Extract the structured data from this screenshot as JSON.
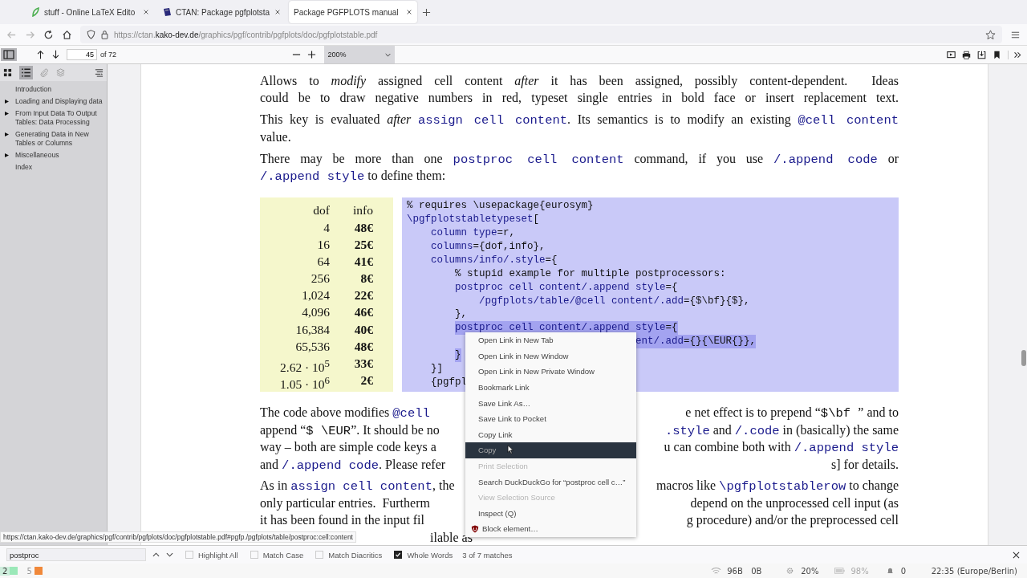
{
  "tabs": [
    {
      "label": "stuff - Online LaTeX Edito",
      "selected": false
    },
    {
      "label": "CTAN: Package pgfplotsta",
      "selected": false
    },
    {
      "label": "Package PGFPLOTS manual",
      "selected": true
    }
  ],
  "address": {
    "scheme": "https://ctan.",
    "domain": "kako-dev.de",
    "path": "/graphics/pgf/contrib/pgfplots/doc/pgfplotstable.pdf"
  },
  "pdf_toolbar": {
    "page": "45",
    "page_count": "of 72",
    "zoom": "200%"
  },
  "sidebar": {
    "items": [
      {
        "label": "Introduction",
        "kind": "leaf"
      },
      {
        "label": "Loading and Displaying data",
        "kind": "branch"
      },
      {
        "label": "From Input Data To Output Tables: Data Processing",
        "kind": "branch"
      },
      {
        "label": "Generating Data in New Tables or Columns",
        "kind": "branch"
      },
      {
        "label": "Miscellaneous",
        "kind": "branch"
      },
      {
        "label": "Index",
        "kind": "leaf"
      }
    ]
  },
  "document": {
    "top_paragraphs": [
      {
        "lines": [
          {
            "kind": "full",
            "left": [
              {
                "kind": "text",
                "t": "Allows to "
              },
              {
                "kind": "em",
                "t": "modify"
              },
              {
                "kind": "text",
                "t": " assigned cell content "
              },
              {
                "kind": "em",
                "t": "after"
              },
              {
                "kind": "text",
                "t": " it has been assigned, possibly content-dependent.  Ideas"
              }
            ]
          },
          {
            "kind": "full",
            "left": [
              {
                "kind": "text",
                "t": "could be to draw negative numbers in red, typeset single entries in bold face or insert replacement text."
              }
            ]
          }
        ]
      },
      {
        "lines": [
          {
            "kind": "full",
            "left": [
              {
                "kind": "text",
                "t": "This key is evaluated "
              },
              {
                "kind": "em",
                "t": "after "
              },
              {
                "kind": "code",
                "t": "assign cell content"
              },
              {
                "kind": "text",
                "t": ". Its semantics is to modify an existing "
              },
              {
                "kind": "code",
                "t": "@cell content"
              }
            ]
          },
          {
            "kind": "last",
            "left": [
              {
                "kind": "text",
                "t": "value."
              }
            ]
          }
        ]
      },
      {
        "lines": [
          {
            "kind": "full",
            "left": [
              {
                "kind": "text",
                "t": "There may be more than one "
              },
              {
                "kind": "code",
                "t": "postproc cell content"
              },
              {
                "kind": "text",
                "t": " command, if you use "
              },
              {
                "kind": "code",
                "t": "/.append code"
              },
              {
                "kind": "text",
                "t": " or"
              }
            ]
          },
          {
            "kind": "last",
            "left": [
              {
                "kind": "code",
                "t": "/.append style"
              },
              {
                "kind": "text",
                "t": " to define them:"
              }
            ]
          }
        ]
      }
    ],
    "example_table": {
      "columns": [
        "dof",
        "info"
      ],
      "rows": [
        [
          "4",
          "48€"
        ],
        [
          "16",
          "25€"
        ],
        [
          "64",
          "41€"
        ],
        [
          "256",
          "8€"
        ],
        [
          "1,024",
          "22€"
        ],
        [
          "4,096",
          "46€"
        ],
        [
          "16,384",
          "40€"
        ],
        [
          "65,536",
          "48€"
        ],
        [
          "2.62 · 10$^{5}$",
          "33€"
        ],
        [
          "1.05 · 10$^{6}$",
          "2€"
        ]
      ]
    },
    "code": [
      {
        "covered": false,
        "selected": false,
        "segs": [
          {
            "kind": "plain",
            "t": "% requires \\usepackage{eurosym}"
          }
        ]
      },
      {
        "covered": false,
        "selected": false,
        "segs": [
          {
            "kind": "kw",
            "t": "\\pgfplotstabletypeset"
          },
          {
            "kind": "plain",
            "t": "["
          }
        ],
        "children": [
          {
            "covered": false,
            "selected": false,
            "segs": [
              {
                "kind": "kw",
                "t": "column type"
              },
              {
                "kind": "plain",
                "t": "=r,"
              }
            ]
          },
          {
            "covered": false,
            "selected": false,
            "segs": [
              {
                "kind": "kw",
                "t": "columns"
              },
              {
                "kind": "plain",
                "t": "={dof,info},"
              }
            ]
          },
          {
            "covered": false,
            "selected": false,
            "segs": [
              {
                "kind": "kw",
                "t": "columns/info/.style"
              },
              {
                "kind": "plain",
                "t": "={"
              }
            ],
            "children": [
              {
                "covered": false,
                "selected": false,
                "segs": [
                  {
                    "kind": "plain",
                    "t": "% stupid example for multiple postprocessors:"
                  }
                ]
              },
              {
                "covered": false,
                "selected": false,
                "segs": [
                  {
                    "kind": "kw",
                    "t": "postproc cell content/.append style"
                  },
                  {
                    "kind": "plain",
                    "t": "={"
                  }
                ],
                "children": [
                  {
                    "covered": false,
                    "selected": false,
                    "segs": [
                      {
                        "kind": "kw",
                        "t": "/pgfplots/table/@cell content/.add"
                      },
                      {
                        "kind": "plain",
                        "t": "={$\\bf}{$},"
                      }
                    ]
                  }
                ]
              },
              {
                "covered": false,
                "selected": false,
                "segs": [
                  {
                    "kind": "plain",
                    "t": "},"
                  }
                ]
              },
              {
                "covered": false,
                "selected": true,
                "segs": [
                  {
                    "kind": "kw",
                    "t": "postproc cell content/.append style"
                  },
                  {
                    "kind": "plain",
                    "t": "={"
                  }
                ],
                "children": [
                  {
                    "covered": true,
                    "selected": true,
                    "segs": [
                      {
                        "kind": "kw",
                        "t": "ent/.add"
                      },
                      {
                        "kind": "plain",
                        "t": "={}{\\EUR{}},"
                      }
                    ]
                  }
                ]
              },
              {
                "covered": false,
                "selected": true,
                "segs": [
                  {
                    "kind": "plain",
                    "t": "}"
                  }
                ]
              }
            ]
          },
          {
            "covered": false,
            "selected": false,
            "segs": [
              {
                "kind": "plain",
                "t": "}]"
              }
            ]
          },
          {
            "covered": false,
            "selected": false,
            "segs": [
              {
                "kind": "plain",
                "t": "{pgfpl"
              }
            ]
          }
        ]
      }
    ],
    "bottom_paragraphs": [
      {
        "lines": [
          {
            "kind": "split",
            "left": [
              {
                "kind": "text",
                "t": "The code above modifies "
              },
              {
                "kind": "code",
                "t": "@cell"
              }
            ],
            "right": [
              {
                "kind": "text",
                "t": "e net effect is to prepend “"
              },
              {
                "kind": "mono",
                "t": "$\\bf "
              },
              {
                "kind": "text",
                "t": "” and to"
              }
            ]
          },
          {
            "kind": "split",
            "left": [
              {
                "kind": "text",
                "t": "append “"
              },
              {
                "kind": "mono",
                "t": "$ \\EUR"
              },
              {
                "kind": "text",
                "t": "”. It should be no"
              }
            ],
            "right": [
              {
                "kind": "code",
                "t": ".style"
              },
              {
                "kind": "text",
                "t": " and "
              },
              {
                "kind": "code",
                "t": "/.code"
              },
              {
                "kind": "text",
                "t": " in (basically) the same"
              }
            ]
          },
          {
            "kind": "split",
            "left": [
              {
                "kind": "text",
                "t": "way – both are simple code keys a"
              }
            ],
            "right": [
              {
                "kind": "text",
                "t": "u can combine both with "
              },
              {
                "kind": "code",
                "t": "/.append style"
              }
            ]
          },
          {
            "kind": "split",
            "left": [
              {
                "kind": "text",
                "t": "and "
              },
              {
                "kind": "code",
                "t": "/.append code"
              },
              {
                "kind": "text",
                "t": ". Please refer"
              }
            ],
            "right": [
              {
                "kind": "text",
                "t": "s] for details."
              }
            ]
          }
        ]
      },
      {
        "lines": [
          {
            "kind": "split",
            "left": [
              {
                "kind": "text",
                "t": "As in "
              },
              {
                "kind": "code",
                "t": "assign cell content"
              },
              {
                "kind": "text",
                "t": ", the"
              }
            ],
            "right": [
              {
                "kind": "text",
                "t": "macros like "
              },
              {
                "kind": "code",
                "t": "\\pgfplotstablerow"
              },
              {
                "kind": "text",
                "t": " to change"
              }
            ]
          },
          {
            "kind": "split",
            "left": [
              {
                "kind": "text",
                "t": "only particular entries.  Furtherm"
              }
            ],
            "right": [
              {
                "kind": "text",
                "t": "depend on the unprocessed cell input (as"
              }
            ]
          },
          {
            "kind": "split",
            "left": [
              {
                "kind": "text",
                "t": "it has been found in the input fil"
              }
            ],
            "right": [
              {
                "kind": "text",
                "t": "g procedure) and/or the preprocessed cell"
              }
            ]
          },
          {
            "kind": "tail",
            "left": [
              {
                "kind": "text",
                "t": "ilable as"
              }
            ]
          }
        ]
      }
    ]
  },
  "context_menu": [
    {
      "label": "Open Link in New Tab",
      "kind": "plain",
      "disabled": false,
      "selected": false
    },
    {
      "label": "Open Link in New Window",
      "kind": "plain",
      "disabled": false,
      "selected": false
    },
    {
      "label": "Open Link in New Private Window",
      "kind": "plain",
      "disabled": false,
      "selected": false
    },
    {
      "label": "Bookmark Link",
      "kind": "plain",
      "disabled": false,
      "selected": false
    },
    {
      "label": "Save Link As…",
      "kind": "plain",
      "disabled": false,
      "selected": false
    },
    {
      "label": "Save Link to Pocket",
      "kind": "plain",
      "disabled": false,
      "selected": false
    },
    {
      "label": "Copy Link",
      "kind": "plain",
      "disabled": false,
      "selected": false
    },
    {
      "label": "Copy",
      "kind": "plain",
      "disabled": false,
      "selected": true
    },
    {
      "label": "Print Selection",
      "kind": "plain",
      "disabled": true,
      "selected": false
    },
    {
      "label": "Search DuckDuckGo for “postproc cell c…”",
      "kind": "plain",
      "disabled": false,
      "selected": false
    },
    {
      "label": "View Selection Source",
      "kind": "plain",
      "disabled": true,
      "selected": false
    },
    {
      "label": "Inspect (Q)",
      "kind": "plain",
      "disabled": false,
      "selected": false
    },
    {
      "label": "Block element…",
      "kind": "shield",
      "disabled": false,
      "selected": false
    }
  ],
  "link_preview": "https://ctan.kako-dev.de/graphics/pgf/contrib/pgfplots/doc/pgfplotstable.pdf#pgfp./pgfplots/table/postproc:cell:content",
  "find_bar": {
    "value": "postproc",
    "options": [
      {
        "label": "Highlight All",
        "checked": false
      },
      {
        "label": "Match Case",
        "checked": false
      },
      {
        "label": "Match Diacritics",
        "checked": false
      },
      {
        "label": "Whole Words",
        "checked": true
      }
    ],
    "result": "3 of 7 matches"
  },
  "taskbar": {
    "workspaces": [
      {
        "label": "2",
        "color": "#9be8b8",
        "selected": true
      },
      {
        "label": "5",
        "color": "#f0883a",
        "selected": false
      }
    ],
    "download": "96B",
    "upload": "0B",
    "cpu": "20%",
    "battery": "98%",
    "notifications": "0",
    "clock": "22:35 (Europe/Berlin)"
  }
}
